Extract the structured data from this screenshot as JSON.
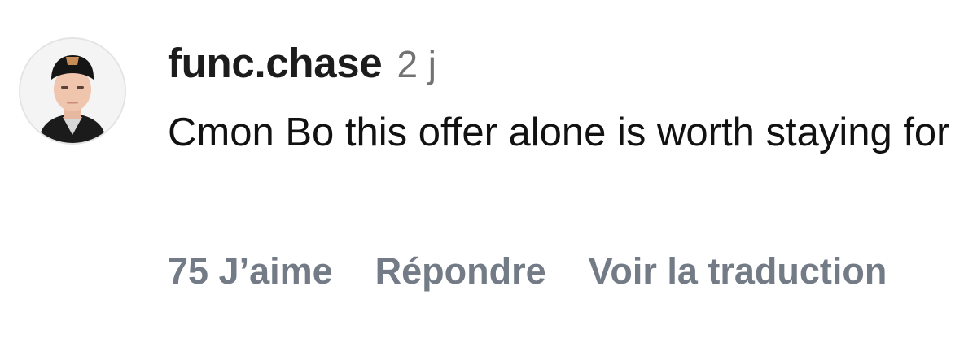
{
  "comment": {
    "username": "func.chase",
    "time": "2 j",
    "text": "Cmon Bo this offer alone is worth staying for",
    "likes": "75 J’aime",
    "reply_label": "Répondre",
    "translate_label": "Voir la traduction"
  },
  "colors": {
    "username": "#1c1c1c",
    "meta": "#737373",
    "actions": "#737b86"
  }
}
